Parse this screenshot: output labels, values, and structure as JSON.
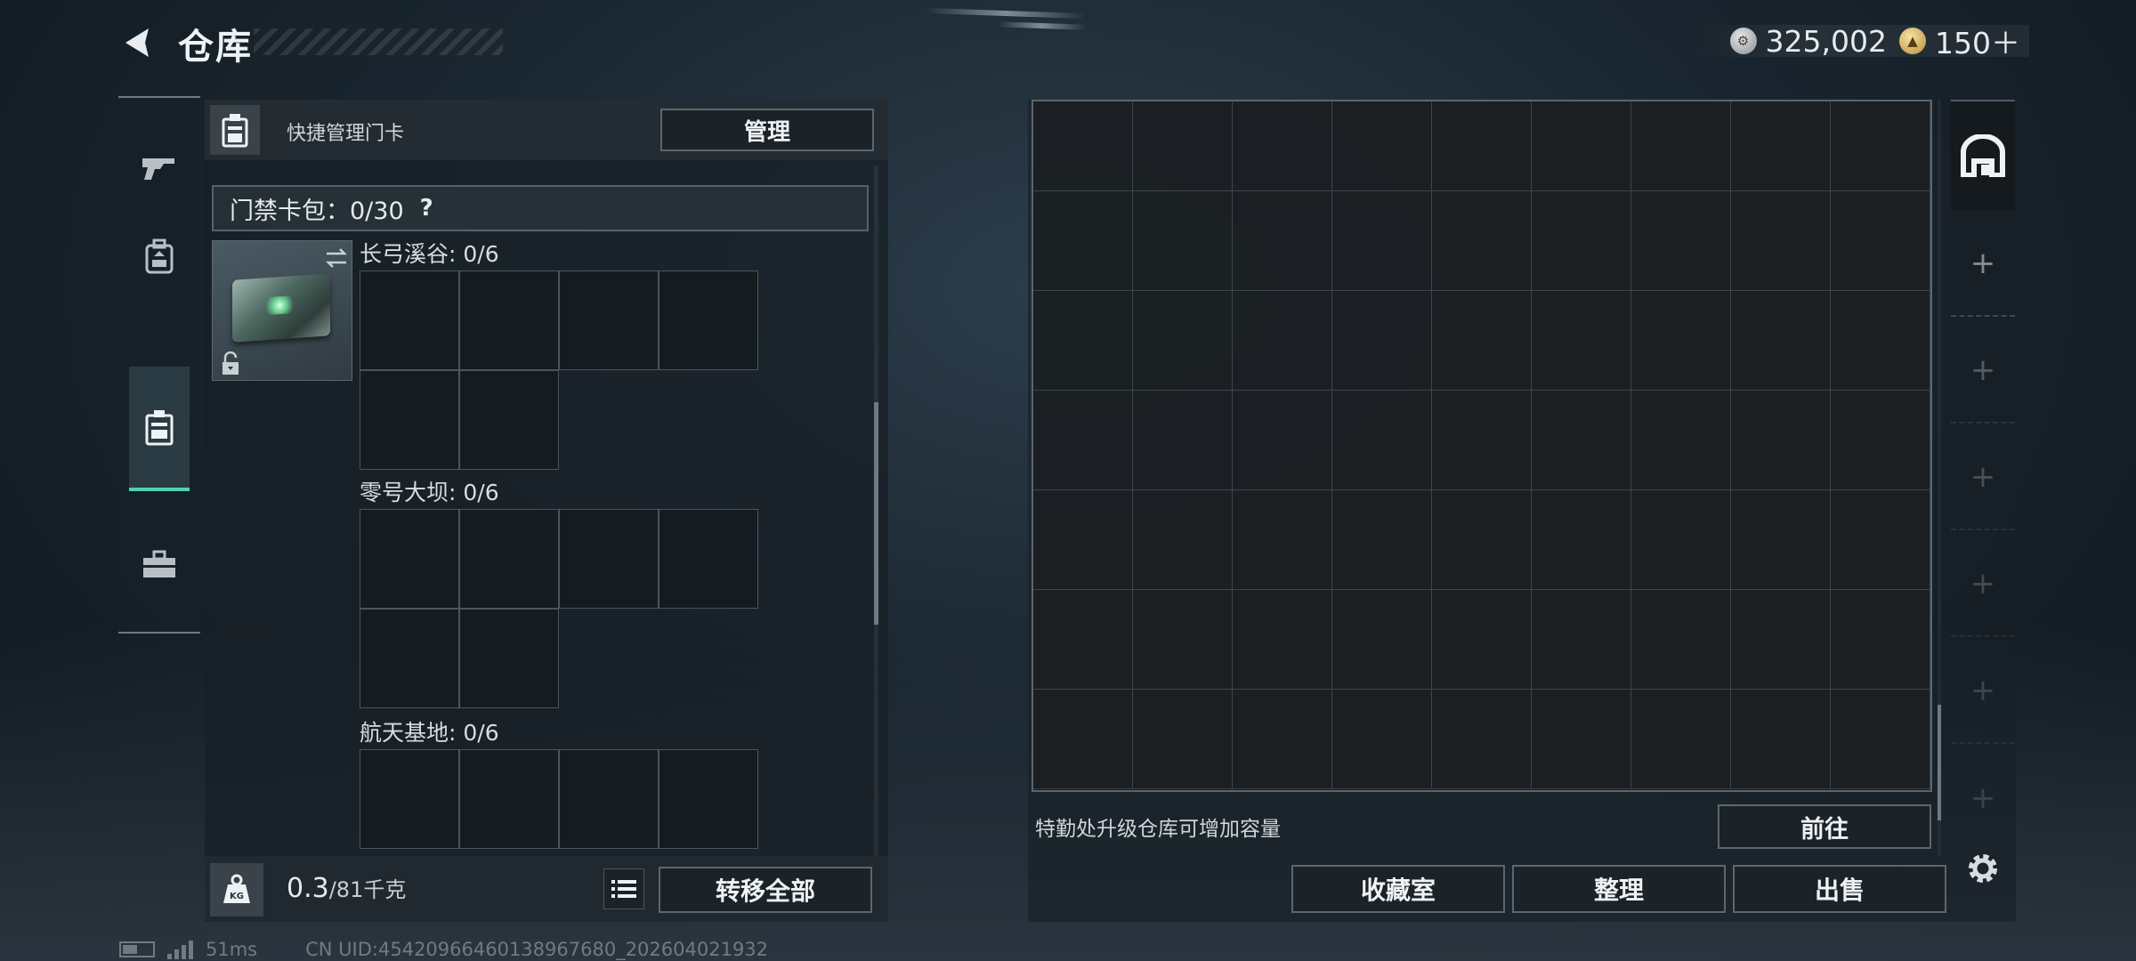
{
  "header": {
    "title": "仓库",
    "currency_silver": "325,002",
    "currency_gold": "150＋"
  },
  "side_tabs": [
    {
      "name": "weapon",
      "icon": "gun-icon"
    },
    {
      "name": "equipment",
      "icon": "backpack-icon"
    },
    {
      "name": "keycard",
      "icon": "keycard-case-icon",
      "active": true
    },
    {
      "name": "toolbox",
      "icon": "toolbox-icon"
    }
  ],
  "left_panel": {
    "header_label": "快捷管理门卡",
    "manage_label": "管理",
    "cardpack_label": "门禁卡包：0/30",
    "cardpack_help": "?",
    "zones": [
      {
        "label": "长弓溪谷: 0/6"
      },
      {
        "label": "零号大坝: 0/6"
      },
      {
        "label": "航天基地: 0/6"
      }
    ],
    "weight_value": "0.3",
    "weight_capacity": "/81千克",
    "transfer_all_label": "转移全部"
  },
  "right_panel": {
    "hint": "特勤处升级仓库可增加容量",
    "goto_label": "前往",
    "actions": [
      "收藏室",
      "整理",
      "出售"
    ]
  },
  "statusbar": {
    "ping": "51ms",
    "uid": "CN UID:4542096646013896768​0_202604021932"
  },
  "colors": {
    "accent": "#4fd1b3",
    "panel": "#182026",
    "border": "#5b6770"
  }
}
